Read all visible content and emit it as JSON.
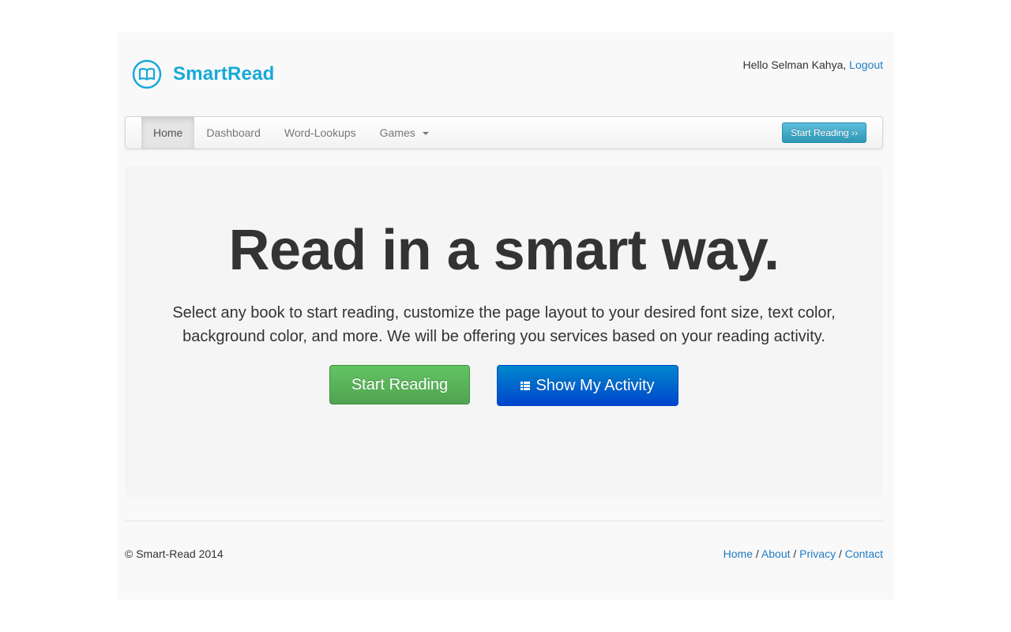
{
  "header": {
    "brand_name": "SmartRead",
    "brand_icon": "open-book-icon",
    "greeting": "Hello Selman Kahya,",
    "logout_label": "Logout"
  },
  "navbar": {
    "items": [
      {
        "label": "Home",
        "active": true
      },
      {
        "label": "Dashboard",
        "active": false
      },
      {
        "label": "Word-Lookups",
        "active": false
      },
      {
        "label": "Games",
        "active": false,
        "dropdown": true
      }
    ],
    "cta_label": "Start Reading ››"
  },
  "hero": {
    "title": "Read in a smart way.",
    "description": "Select any book to start reading, customize the page layout to your desired font size, text color, background color, and more. We will be offering you services based on your reading activity.",
    "primary_button": "Start Reading",
    "secondary_button": "Show My Activity",
    "secondary_icon": "list-icon"
  },
  "footer": {
    "copyright": "© Smart-Read 2014",
    "links": [
      "Home",
      "About",
      "Privacy",
      "Contact"
    ],
    "separator": " / "
  },
  "colors": {
    "brand": "#17a9d9",
    "link": "#1f7cc4",
    "success": "#51a351",
    "primary": "#0044cc",
    "info": "#2f96b4"
  }
}
